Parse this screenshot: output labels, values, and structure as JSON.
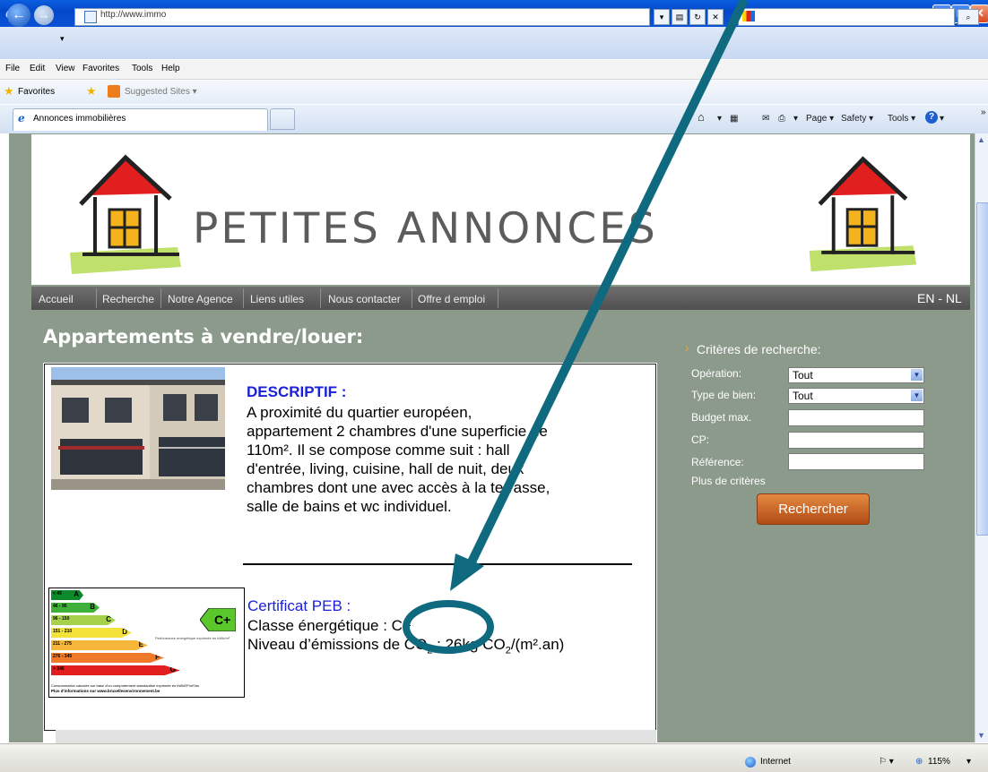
{
  "browser": {
    "address": "http://www.immo",
    "menu": [
      "File",
      "Edit",
      "View",
      "Favorites",
      "Tools",
      "Help"
    ],
    "favorites_label": "Favorites",
    "suggested_sites": "Suggested Sites",
    "tab_title": "Annonces immobilières",
    "commands": {
      "page": "Page",
      "safety": "Safety",
      "tools": "Tools"
    },
    "status_zone": "Internet",
    "zoom": "115%",
    "icons": [
      "ie-logo-icon",
      "back-icon",
      "forward-icon",
      "refresh-icon",
      "stop-icon",
      "search-icon",
      "home-icon",
      "feeds-icon",
      "mail-icon",
      "print-icon",
      "help-icon",
      "globe-icon"
    ]
  },
  "site": {
    "title": "PETITES ANNONCES",
    "nav": [
      "Accueil",
      "Recherche",
      "Notre Agence",
      "Liens utiles",
      "Nous contacter",
      "Offre d emploi"
    ],
    "lang": "EN - NL",
    "page_heading": "Appartements à vendre/louer:"
  },
  "listing": {
    "descriptif_title": "DESCRIPTIF :",
    "desc_lines": [
      "A proximité du quartier européen,",
      "appartement 2 chambres d'une superficie de",
      "110m². Il se compose comme suit : hall",
      "d'entrée, living, cuisine, hall de nuit, deux",
      "chambres dont une avec accès à la terrasse,",
      "salle de bains et wc individuel."
    ],
    "peb_title": "Certificat PEB :",
    "classe": "Classe énergétique : C+",
    "emission_prefix": "Niveau d’émissions de CO",
    "emission_sub1": "2",
    "emission_mid": " : 26kg CO",
    "emission_sub2": "2",
    "emission_suffix": "/(m².an)",
    "peb_badge": "C+",
    "peb_bands": [
      {
        "range": "< 45",
        "letter": "A",
        "color": "#0a8a2a"
      },
      {
        "range": "46 - 95",
        "letter": "B",
        "color": "#3fb03a"
      },
      {
        "range": "96 - 150",
        "letter": "C",
        "color": "#a5d24a"
      },
      {
        "range": "151 - 210",
        "letter": "D",
        "color": "#f2e23a"
      },
      {
        "range": "211 - 275",
        "letter": "E",
        "color": "#f6b63a"
      },
      {
        "range": "276 - 345",
        "letter": "F",
        "color": "#ee7a2a"
      },
      {
        "range": "> 346",
        "letter": "G",
        "color": "#e21f1f"
      }
    ],
    "peb_caption": "Performance énergétique exprimée en kWh/m²",
    "peb_footnote1": "Consommation calculée sur base d'un comportement standardisé exprimée en kWhEP/m²/an",
    "peb_footnote2": "Plus d'informations sur www.bruxellesenvironnement.be"
  },
  "search": {
    "title": "Critères de recherche:",
    "operation_label": "Opération:",
    "operation_value": "Tout",
    "type_label": "Type de bien:",
    "type_value": "Tout",
    "budget_label": "Budget max.",
    "cp_label": "CP:",
    "ref_label": "Référence:",
    "more": "Plus de critères",
    "button": "Rechercher"
  },
  "colors": {
    "annotation": "#0f6a80",
    "title_blue": "#1a21d8",
    "page_bg": "#8c9a8b",
    "search_button": "#c8642a"
  }
}
